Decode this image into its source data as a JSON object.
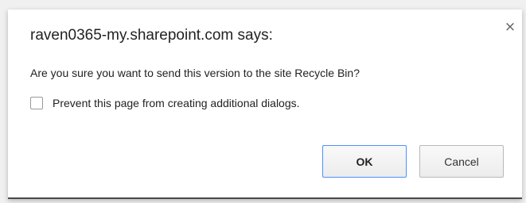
{
  "dialog": {
    "title": "raven0365-my.sharepoint.com says:",
    "message": "Are you sure you want to send this version to the site Recycle Bin?",
    "checkbox_label": "Prevent this page from creating additional dialogs.",
    "checkbox_checked": false,
    "close_glyph": "×",
    "ok_label": "OK",
    "cancel_label": "Cancel"
  },
  "colors": {
    "focus_border": "#4d90fe",
    "text": "#222222"
  }
}
